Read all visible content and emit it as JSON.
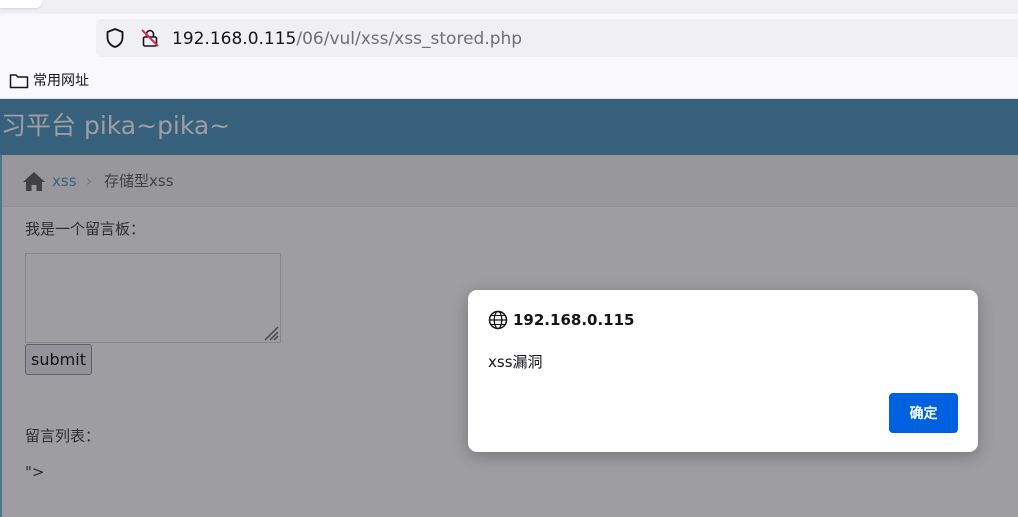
{
  "browser": {
    "url_host": "192.168.0.115",
    "url_path": "/06/vul/xss/xss_stored.php",
    "bookmarks": [
      {
        "label": "常用网址",
        "icon": "folder-icon"
      }
    ]
  },
  "site": {
    "title": "练习平台 pika~pika~",
    "header_color": "#438eb9"
  },
  "breadcrumb": {
    "icon": "home-icon",
    "link": "xss",
    "separator": "›",
    "current": "存储型xss"
  },
  "form": {
    "label": "我是一个留言板：",
    "textarea_value": "",
    "submit_label": "submit"
  },
  "messages": {
    "label": "留言列表：",
    "items": [
      "\">"
    ]
  },
  "dialog": {
    "icon": "globe-icon",
    "title": "192.168.0.115",
    "message": "xss漏洞",
    "ok_label": "确定",
    "ok_color": "#0061e0"
  }
}
